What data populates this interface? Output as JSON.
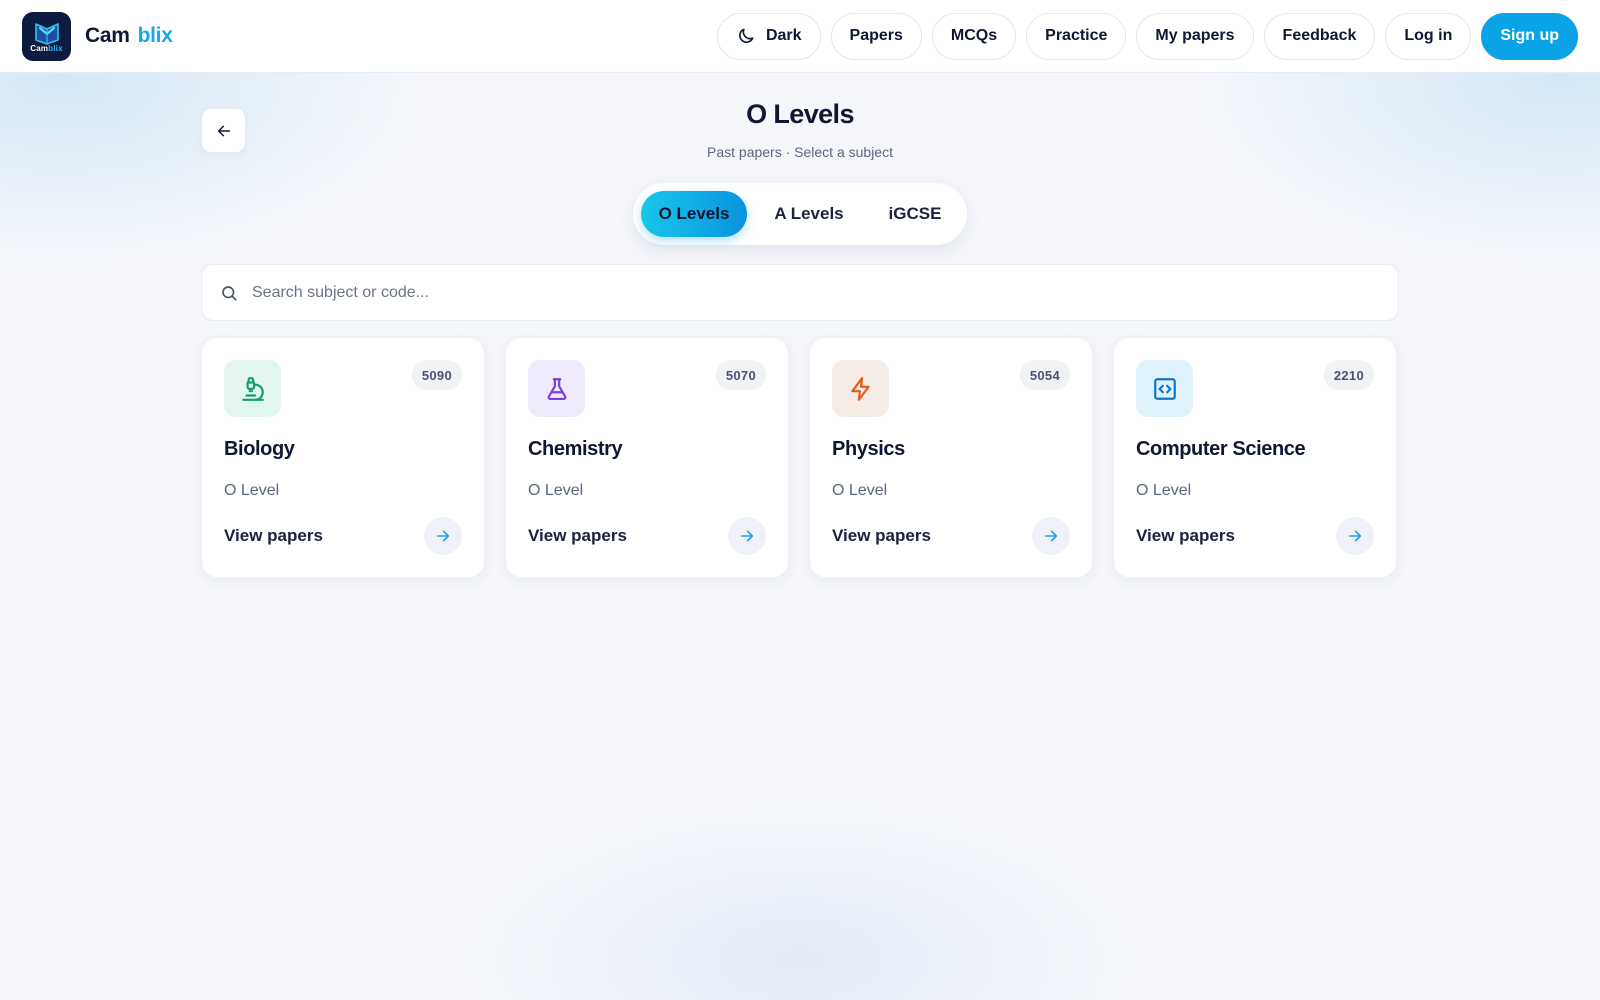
{
  "brand": {
    "logo_text_a": "Cam",
    "logo_text_b": "blix",
    "name_part1": "Cam",
    "name_part2": "blix"
  },
  "nav": {
    "theme_label": "Dark",
    "theme_icon": "moon-icon",
    "papers": "Papers",
    "mcqs": "MCQs",
    "practice": "Practice",
    "my_papers": "My papers",
    "feedback": "Feedback",
    "login": "Log in",
    "signup": "Sign up"
  },
  "page": {
    "title": "O Levels",
    "subtitle": "Past papers · Select a subject",
    "back_icon": "arrow-left-icon"
  },
  "tabs": [
    {
      "label": "O Levels",
      "active": true
    },
    {
      "label": "A Levels",
      "active": false
    },
    {
      "label": "iGCSE",
      "active": false
    }
  ],
  "search": {
    "placeholder": "Search subject or code...",
    "value": "",
    "icon": "search-icon"
  },
  "subjects": [
    {
      "name": "Biology",
      "code": "5090",
      "level": "O Level",
      "action": "View papers",
      "icon": "microscope-icon",
      "icon_color": "#14a06a",
      "icon_bg": "#e2f5ee"
    },
    {
      "name": "Chemistry",
      "code": "5070",
      "level": "O Level",
      "action": "View papers",
      "icon": "flask-icon",
      "icon_color": "#7a3fe0",
      "icon_bg": "#eeeafb"
    },
    {
      "name": "Physics",
      "code": "5054",
      "level": "O Level",
      "action": "View papers",
      "icon": "lightning-icon",
      "icon_color": "#ea5a16",
      "icon_bg": "#f6ece6"
    },
    {
      "name": "Computer Science",
      "code": "2210",
      "level": "O Level",
      "action": "View papers",
      "icon": "code-icon",
      "icon_color": "#0b78c8",
      "icon_bg": "#dff2fb"
    }
  ],
  "colors": {
    "accent": "#0aa3e8",
    "arrow": "#1aa7e8"
  }
}
